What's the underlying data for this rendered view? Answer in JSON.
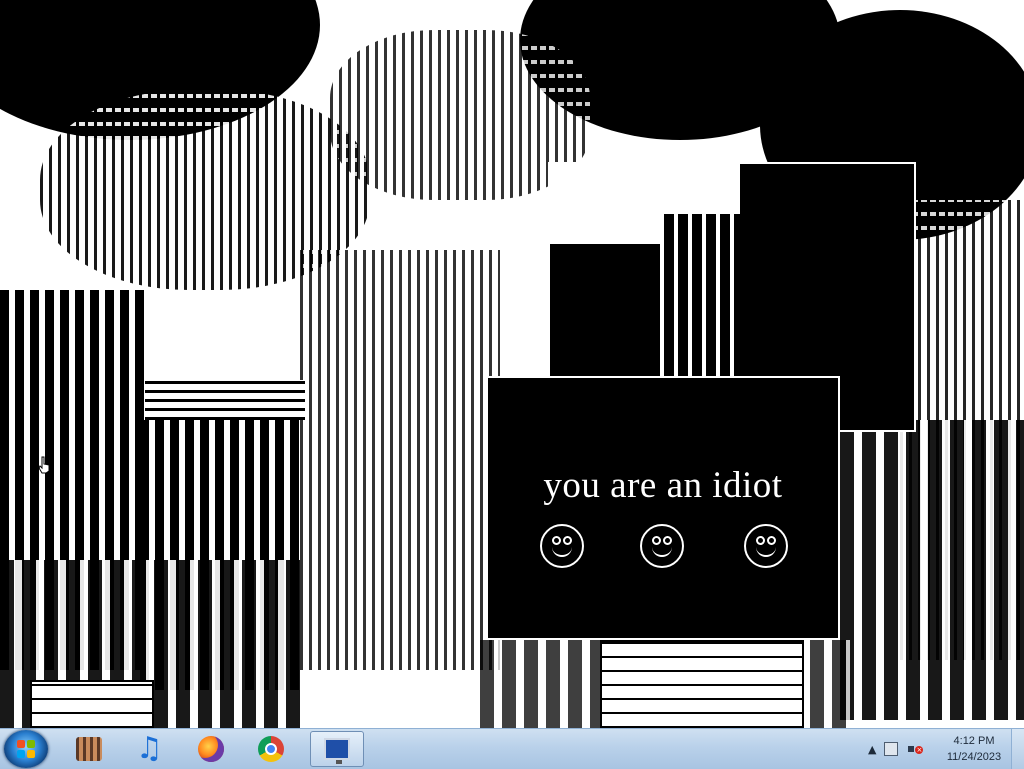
{
  "popup": {
    "message": "you are an idiot",
    "faces": [
      "smiley-face",
      "smiley-face",
      "smiley-face"
    ],
    "background_color": "#000000",
    "text_color": "#ffffff"
  },
  "taskbar": {
    "start_icon": "windows-logo-icon",
    "pinned": [
      {
        "name": "film-app-icon"
      },
      {
        "name": "itunes-icon"
      },
      {
        "name": "firefox-icon"
      },
      {
        "name": "chrome-icon"
      },
      {
        "name": "remote-desktop-icon",
        "active": true
      }
    ],
    "tray": {
      "show_hidden_icon": "▲",
      "icons": [
        "network-icon",
        "speaker-muted-icon"
      ]
    },
    "clock": {
      "time": "4:12 PM",
      "date": "11/24/2023"
    }
  }
}
